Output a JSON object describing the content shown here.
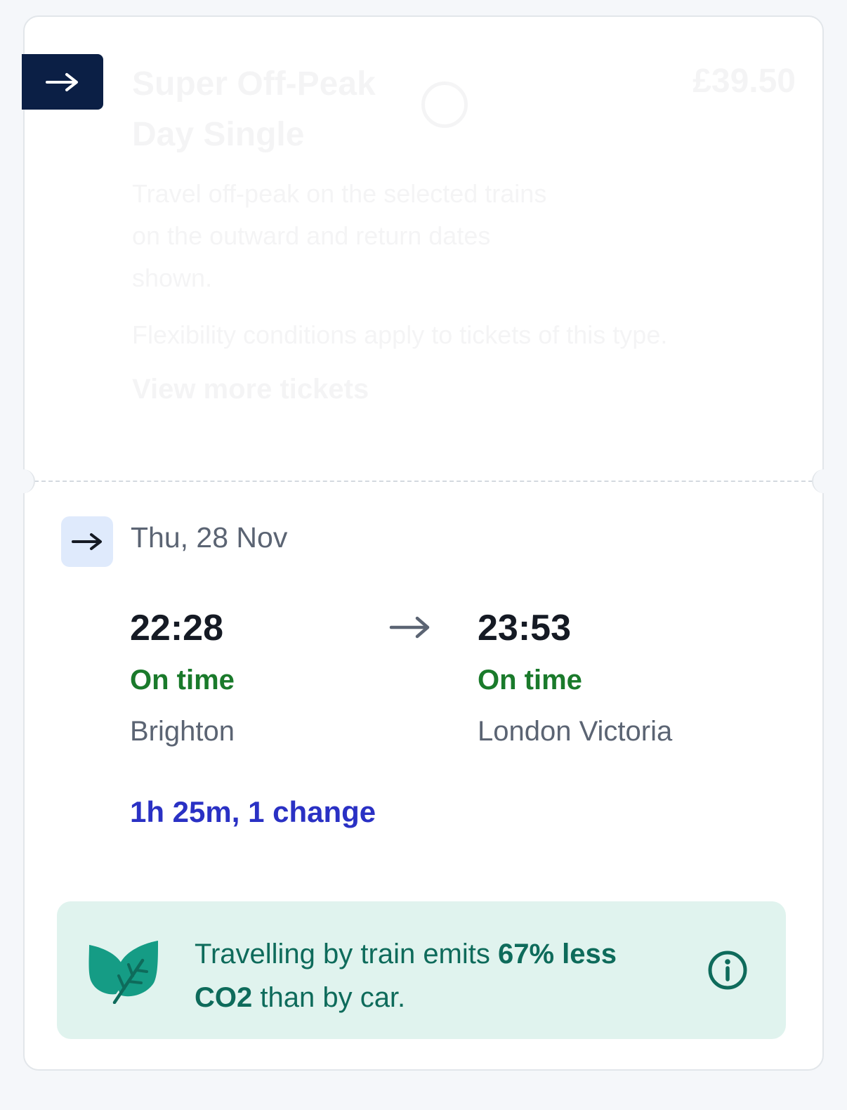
{
  "ticket": {
    "name": "Super Off-Peak Day Single",
    "price": "£39.50",
    "description": "Travel off-peak on the selected trains on the outward and return dates shown.",
    "more_info": "Flexibility conditions apply to tickets of this type.",
    "view_more": "View more tickets"
  },
  "journey": {
    "date": "Thu, 28 Nov",
    "depart_time": "22:28",
    "depart_status": "On time",
    "depart_station": "Brighton",
    "arrive_time": "23:53",
    "arrive_status": "On time",
    "arrive_station": "London Victoria",
    "duration": "1h 25m, 1 change"
  },
  "eco": {
    "text_a": "Travelling by train emits ",
    "text_bold": "67% less CO2",
    "text_b": " than by car."
  },
  "icons": {
    "direction_tab": "arrow-right-icon",
    "direction_badge": "arrow-right-icon",
    "route_arrow": "arrow-right-icon",
    "eco": "leaf-icon",
    "info": "info-icon"
  },
  "colors": {
    "navy": "#0b1f45",
    "on_time_green": "#1a7a2b",
    "duration_blue": "#2a31c4",
    "eco_bg": "#e0f3ee",
    "eco_text": "#0e6b5b"
  }
}
